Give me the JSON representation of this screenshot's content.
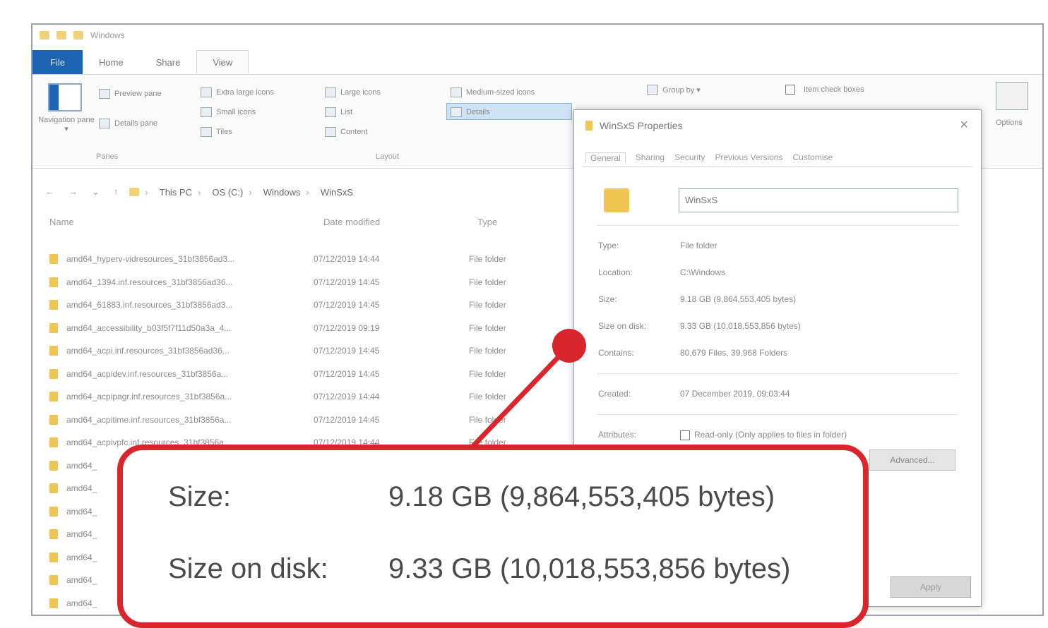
{
  "titlebar": {
    "title": "Windows"
  },
  "ribbon": {
    "tabs": [
      "File",
      "Home",
      "Share",
      "View"
    ],
    "pane": {
      "navigation_pane": "Navigation pane ▾",
      "preview_pane": "Preview pane",
      "details_pane": "Details pane",
      "group_label": "Panes"
    },
    "layout": {
      "extra_large_icons": "Extra large icons",
      "large_icons": "Large icons",
      "medium_icons": "Medium-sized icons",
      "small_icons": "Small icons",
      "list": "List",
      "details": "Details",
      "tiles": "Tiles",
      "content": "Content",
      "group_label": "Layout"
    },
    "current_view": {
      "group_by": "Group by ▾",
      "item_check_boxes": "Item check boxes"
    },
    "options_label": "Options"
  },
  "address_bar": {
    "crumbs": [
      "This PC",
      "OS (C:)",
      "Windows",
      "WinSxS"
    ]
  },
  "file_list": {
    "columns": {
      "name": "Name",
      "date": "Date modified",
      "type": "Type"
    },
    "rows": [
      {
        "name": "amd64_hyperv-vidresources_31bf3856ad3...",
        "date": "07/12/2019 14:44",
        "type": "File folder"
      },
      {
        "name": "amd64_1394.inf.resources_31bf3856ad36...",
        "date": "07/12/2019 14:45",
        "type": "File folder"
      },
      {
        "name": "amd64_61883.inf.resources_31bf3856ad3...",
        "date": "07/12/2019 14:45",
        "type": "File folder"
      },
      {
        "name": "amd64_accessibility_b03f5f7f11d50a3a_4...",
        "date": "07/12/2019 09:19",
        "type": "File folder"
      },
      {
        "name": "amd64_acpi.inf.resources_31bf3856ad36...",
        "date": "07/12/2019 14:45",
        "type": "File folder"
      },
      {
        "name": "amd64_acpidev.inf.resources_31bf3856a...",
        "date": "07/12/2019 14:45",
        "type": "File folder"
      },
      {
        "name": "amd64_acpipagr.inf.resources_31bf3856a...",
        "date": "07/12/2019 14:44",
        "type": "File folder"
      },
      {
        "name": "amd64_acpitime.inf.resources_31bf3856a...",
        "date": "07/12/2019 14:45",
        "type": "File folder"
      },
      {
        "name": "amd64_acpivpfc.inf.resources_31bf3856a...",
        "date": "07/12/2019 14:44",
        "type": "File folder"
      },
      {
        "name": "amd64_",
        "date": "",
        "type": ""
      },
      {
        "name": "amd64_",
        "date": "",
        "type": ""
      },
      {
        "name": "amd64_",
        "date": "",
        "type": ""
      },
      {
        "name": "amd64_",
        "date": "",
        "type": ""
      },
      {
        "name": "amd64_",
        "date": "",
        "type": ""
      },
      {
        "name": "amd64_",
        "date": "",
        "type": ""
      },
      {
        "name": "amd64_",
        "date": "",
        "type": ""
      }
    ]
  },
  "dialog": {
    "title": "WinSxS Properties",
    "tabs": [
      "General",
      "Sharing",
      "Security",
      "Previous Versions",
      "Customise"
    ],
    "folder_name": "WinSxS",
    "props": [
      {
        "key": "Type:",
        "value": "File folder"
      },
      {
        "key": "Location:",
        "value": "C:\\Windows"
      },
      {
        "key": "Size:",
        "value": "9.18 GB (9,864,553,405 bytes)"
      },
      {
        "key": "Size on disk:",
        "value": "9.33 GB (10,018,553,856 bytes)"
      },
      {
        "key": "Contains:",
        "value": "80,679 Files, 39,968 Folders"
      }
    ],
    "created": {
      "key": "Created:",
      "value": "07 December 2019, 09:03:44"
    },
    "attributes": {
      "key": "Attributes:",
      "value": "Read-only (Only applies to files in folder)"
    },
    "advanced_label": "Advanced...",
    "apply_label": "Apply"
  },
  "callout": {
    "size_label": "Size:",
    "size_value": "9.18 GB (9,864,553,405 bytes)",
    "size_on_disk_label": "Size on disk:",
    "size_on_disk_value": "9.33 GB (10,018,553,856 bytes)",
    "color": "#d8262c"
  }
}
